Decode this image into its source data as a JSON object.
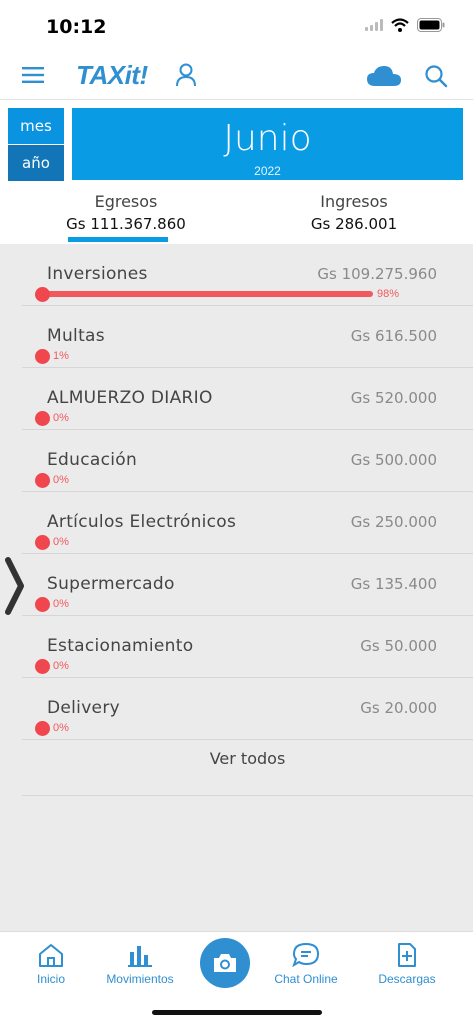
{
  "status": {
    "time": "10:12"
  },
  "header": {
    "logo": "TAXit!"
  },
  "period": {
    "tab_month": "mes",
    "tab_year": "año",
    "month": "Junio",
    "year": "2022"
  },
  "totals": {
    "egresos_label": "Egresos",
    "egresos_value": "Gs 111.367.860",
    "ingresos_label": "Ingresos",
    "ingresos_value": "Gs 286.001"
  },
  "categories": [
    {
      "name": "Inversiones",
      "amount": "Gs 109.275.960",
      "percent": "98%",
      "fraction": 0.98
    },
    {
      "name": "Multas",
      "amount": "Gs 616.500",
      "percent": "1%",
      "fraction": 0.01
    },
    {
      "name": "ALMUERZO DIARIO",
      "amount": "Gs 520.000",
      "percent": "0%",
      "fraction": 0
    },
    {
      "name": "Educación",
      "amount": "Gs 500.000",
      "percent": "0%",
      "fraction": 0
    },
    {
      "name": "Artículos Electrónicos",
      "amount": "Gs 250.000",
      "percent": "0%",
      "fraction": 0
    },
    {
      "name": "Supermercado",
      "amount": "Gs 135.400",
      "percent": "0%",
      "fraction": 0
    },
    {
      "name": "Estacionamiento",
      "amount": "Gs 50.000",
      "percent": "0%",
      "fraction": 0
    },
    {
      "name": "Delivery",
      "amount": "Gs 20.000",
      "percent": "0%",
      "fraction": 0
    }
  ],
  "list": {
    "ver_todos": "Ver todos"
  },
  "nav": {
    "inicio": "Inicio",
    "movimientos": "Movimientos",
    "chat": "Chat Online",
    "descargas": "Descargas"
  },
  "colors": {
    "accent": "#0a9be5",
    "brand": "#2f8fd0",
    "bar": "#f05a5f"
  },
  "icons": [
    "menu-icon",
    "user-icon",
    "cloud-icon",
    "search-icon",
    "home-icon",
    "bar-chart-icon",
    "camera-icon",
    "chat-icon",
    "download-icon",
    "chevron-right-icon"
  ]
}
